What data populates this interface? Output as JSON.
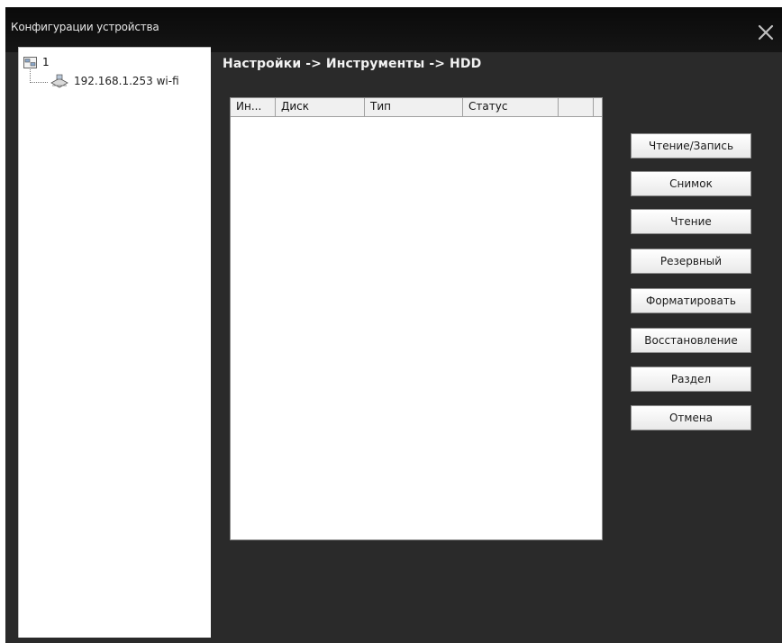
{
  "window": {
    "title": "Конфигурации устройства"
  },
  "tree": {
    "root_label": "1",
    "child_label": "192.168.1.253 wi-fi"
  },
  "breadcrumb": "Настройки -> Инструменты -> HDD",
  "table": {
    "columns": [
      "Ин...",
      "Диск",
      "Тип",
      "Статус",
      ""
    ],
    "rows": []
  },
  "buttons": {
    "read_write": "Чтение/Запись",
    "snapshot": "Снимок",
    "read": "Чтение",
    "redundant": "Резервный",
    "format": "Форматировать",
    "restore": "Восстановление",
    "partition": "Раздел",
    "cancel": "Отмена"
  },
  "icons": {
    "root": "device-group-icon",
    "child": "network-device-icon",
    "close": "close-icon"
  }
}
